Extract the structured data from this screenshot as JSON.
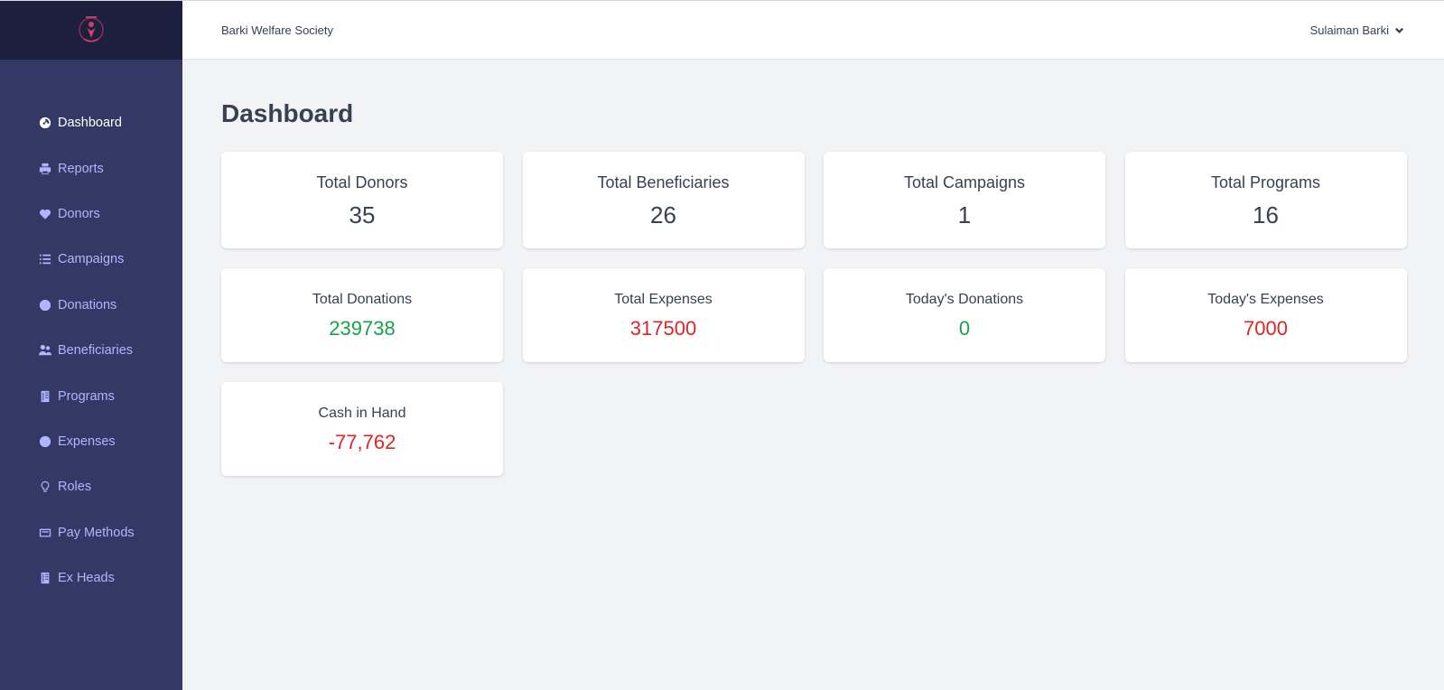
{
  "app": {
    "org_name": "Barki Welfare Society"
  },
  "user": {
    "name": "Sulaiman Barki"
  },
  "sidebar": {
    "items": [
      {
        "label": "Dashboard",
        "icon": "dashboard-icon",
        "active": true
      },
      {
        "label": "Reports",
        "icon": "printer-icon"
      },
      {
        "label": "Donors",
        "icon": "heart-icon"
      },
      {
        "label": "Campaigns",
        "icon": "list-icon"
      },
      {
        "label": "Donations",
        "icon": "circle-icon"
      },
      {
        "label": "Beneficiaries",
        "icon": "users-icon"
      },
      {
        "label": "Programs",
        "icon": "book-icon"
      },
      {
        "label": "Expenses",
        "icon": "circle-icon"
      },
      {
        "label": "Roles",
        "icon": "lightbulb-icon"
      },
      {
        "label": "Pay Methods",
        "icon": "card-icon"
      },
      {
        "label": "Ex Heads",
        "icon": "book-icon"
      }
    ]
  },
  "page": {
    "title": "Dashboard"
  },
  "stats": {
    "total_donors": {
      "label": "Total Donors",
      "value": "35"
    },
    "total_beneficiaries": {
      "label": "Total Beneficiaries",
      "value": "26"
    },
    "total_campaigns": {
      "label": "Total Campaigns",
      "value": "1"
    },
    "total_programs": {
      "label": "Total Programs",
      "value": "16"
    },
    "total_donations": {
      "label": "Total Donations",
      "value": "239738"
    },
    "total_expenses": {
      "label": "Total Expenses",
      "value": "317500"
    },
    "todays_donations": {
      "label": "Today's Donations",
      "value": "0"
    },
    "todays_expenses": {
      "label": "Today's Expenses",
      "value": "7000"
    },
    "cash_in_hand": {
      "label": "Cash in Hand",
      "value": "-77,762"
    }
  },
  "colors": {
    "sidebar_bg": "#343865",
    "logo_bar_bg": "#1c1f3d",
    "nav_text": "#aeb6ff",
    "positive": "#16a34a",
    "negative": "#dc2626"
  }
}
